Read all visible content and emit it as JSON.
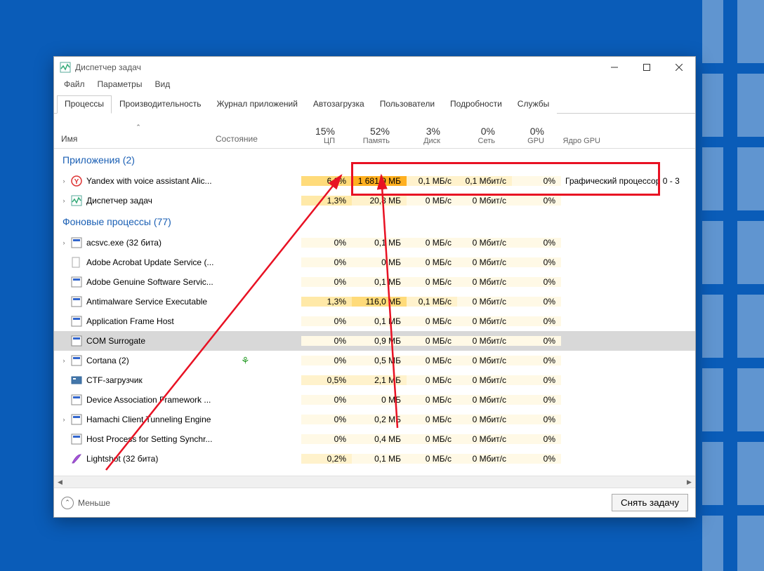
{
  "window": {
    "title": "Диспетчер задач"
  },
  "menus": {
    "file": "Файл",
    "options": "Параметры",
    "view": "Вид"
  },
  "tabs": {
    "processes": "Процессы",
    "performance": "Производительность",
    "app_history": "Журнал приложений",
    "startup": "Автозагрузка",
    "users": "Пользователи",
    "details": "Подробности",
    "services": "Службы"
  },
  "columns": {
    "name": "Имя",
    "status": "Состояние",
    "cpu_pct": "15%",
    "cpu_lbl": "ЦП",
    "mem_pct": "52%",
    "mem_lbl": "Память",
    "disk_pct": "3%",
    "disk_lbl": "Диск",
    "net_pct": "0%",
    "net_lbl": "Сеть",
    "gpu_pct": "0%",
    "gpu_lbl": "GPU",
    "gpucore_lbl": "Ядро GPU"
  },
  "groups": {
    "apps": "Приложения (2)",
    "bg": "Фоновые процессы (77)"
  },
  "rows": {
    "apps": [
      {
        "name": "Yandex with voice assistant Alic...",
        "icon": "yandex",
        "expand": true,
        "cpu": "6,8%",
        "cpuH": 3,
        "mem": "1 681,9 МБ",
        "memH": 5,
        "disk": "0,1 МБ/с",
        "diskH": 1,
        "net": "0,1 Мбит/с",
        "netH": 1,
        "gpu": "0%",
        "gpuH": 0,
        "gpucore": "Графический процессор 0 - 3"
      },
      {
        "name": "Диспетчер задач",
        "icon": "taskmgr",
        "expand": true,
        "cpu": "1,3%",
        "cpuH": 2,
        "mem": "20,8 МБ",
        "memH": 1,
        "disk": "0 МБ/с",
        "diskH": 0,
        "net": "0 Мбит/с",
        "netH": 0,
        "gpu": "0%",
        "gpuH": 0,
        "gpucore": ""
      }
    ],
    "bg": [
      {
        "name": "acsvc.exe (32 бита)",
        "icon": "exe",
        "expand": true,
        "cpu": "0%",
        "cpuH": 0,
        "mem": "0,1 МБ",
        "memH": 0,
        "disk": "0 МБ/с",
        "diskH": 0,
        "net": "0 Мбит/с",
        "netH": 0,
        "gpu": "0%",
        "gpuH": 0,
        "gpucore": ""
      },
      {
        "name": "Adobe Acrobat Update Service (...",
        "icon": "blank",
        "cpu": "0%",
        "cpuH": 0,
        "mem": "0 МБ",
        "memH": 0,
        "disk": "0 МБ/с",
        "diskH": 0,
        "net": "0 Мбит/с",
        "netH": 0,
        "gpu": "0%",
        "gpuH": 0,
        "gpucore": ""
      },
      {
        "name": "Adobe Genuine Software Servic...",
        "icon": "exe",
        "cpu": "0%",
        "cpuH": 0,
        "mem": "0,1 МБ",
        "memH": 0,
        "disk": "0 МБ/с",
        "diskH": 0,
        "net": "0 Мбит/с",
        "netH": 0,
        "gpu": "0%",
        "gpuH": 0,
        "gpucore": ""
      },
      {
        "name": "Antimalware Service Executable",
        "icon": "exe",
        "cpu": "1,3%",
        "cpuH": 2,
        "mem": "116,0 МБ",
        "memH": 3,
        "disk": "0,1 МБ/с",
        "diskH": 1,
        "net": "0 Мбит/с",
        "netH": 0,
        "gpu": "0%",
        "gpuH": 0,
        "gpucore": ""
      },
      {
        "name": "Application Frame Host",
        "icon": "exe",
        "cpu": "0%",
        "cpuH": 0,
        "mem": "0,1 МБ",
        "memH": 0,
        "disk": "0 МБ/с",
        "diskH": 0,
        "net": "0 Мбит/с",
        "netH": 0,
        "gpu": "0%",
        "gpuH": 0,
        "gpucore": ""
      },
      {
        "name": "COM Surrogate",
        "icon": "exe",
        "selected": true,
        "cpu": "0%",
        "cpuH": 0,
        "mem": "0,9 МБ",
        "memH": 0,
        "disk": "0 МБ/с",
        "diskH": 0,
        "net": "0 Мбит/с",
        "netH": 0,
        "gpu": "0%",
        "gpuH": 0,
        "gpucore": ""
      },
      {
        "name": "Cortana (2)",
        "icon": "exe",
        "expand": true,
        "leaf": true,
        "cpu": "0%",
        "cpuH": 0,
        "mem": "0,5 МБ",
        "memH": 0,
        "disk": "0 МБ/с",
        "diskH": 0,
        "net": "0 Мбит/с",
        "netH": 0,
        "gpu": "0%",
        "gpuH": 0,
        "gpucore": ""
      },
      {
        "name": "CTF-загрузчик",
        "icon": "ctf",
        "cpu": "0,5%",
        "cpuH": 1,
        "mem": "2,1 МБ",
        "memH": 1,
        "disk": "0 МБ/с",
        "diskH": 0,
        "net": "0 Мбит/с",
        "netH": 0,
        "gpu": "0%",
        "gpuH": 0,
        "gpucore": ""
      },
      {
        "name": "Device Association Framework ...",
        "icon": "exe",
        "cpu": "0%",
        "cpuH": 0,
        "mem": "0 МБ",
        "memH": 0,
        "disk": "0 МБ/с",
        "diskH": 0,
        "net": "0 Мбит/с",
        "netH": 0,
        "gpu": "0%",
        "gpuH": 0,
        "gpucore": ""
      },
      {
        "name": "Hamachi Client Tunneling Engine",
        "icon": "exe",
        "expand": true,
        "cpu": "0%",
        "cpuH": 0,
        "mem": "0,2 МБ",
        "memH": 0,
        "disk": "0 МБ/с",
        "diskH": 0,
        "net": "0 Мбит/с",
        "netH": 0,
        "gpu": "0%",
        "gpuH": 0,
        "gpucore": ""
      },
      {
        "name": "Host Process for Setting Synchr...",
        "icon": "exe",
        "cpu": "0%",
        "cpuH": 0,
        "mem": "0,4 МБ",
        "memH": 0,
        "disk": "0 МБ/с",
        "diskH": 0,
        "net": "0 Мбит/с",
        "netH": 0,
        "gpu": "0%",
        "gpuH": 0,
        "gpucore": ""
      },
      {
        "name": "Lightshot (32 бита)",
        "icon": "feather",
        "cpu": "0,2%",
        "cpuH": 1,
        "mem": "0,1 МБ",
        "memH": 0,
        "disk": "0 МБ/с",
        "diskH": 0,
        "net": "0 Мбит/с",
        "netH": 0,
        "gpu": "0%",
        "gpuH": 0,
        "gpucore": ""
      }
    ]
  },
  "footer": {
    "fewer": "Меньше",
    "end_task": "Снять задачу"
  }
}
